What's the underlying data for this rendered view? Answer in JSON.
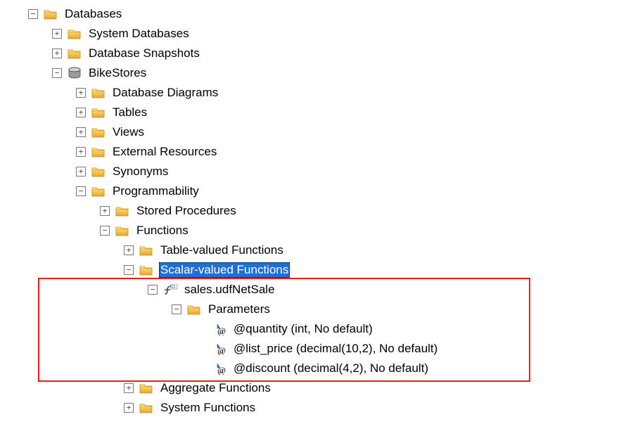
{
  "tree": {
    "databases": "Databases",
    "system_databases": "System Databases",
    "database_snapshots": "Database Snapshots",
    "bikestores": "BikeStores",
    "database_diagrams": "Database Diagrams",
    "tables": "Tables",
    "views": "Views",
    "external_resources": "External Resources",
    "synonyms": "Synonyms",
    "programmability": "Programmability",
    "stored_procedures": "Stored Procedures",
    "functions": "Functions",
    "table_valued_functions": "Table-valued Functions",
    "scalar_valued_functions": "Scalar-valued Functions",
    "function_name": "sales.udfNetSale",
    "parameters": "Parameters",
    "param_quantity": "@quantity (int, No default)",
    "param_list_price": "@list_price (decimal(10,2), No default)",
    "param_discount": "@discount (decimal(4,2), No default)",
    "aggregate_functions": "Aggregate Functions",
    "system_functions": "System Functions"
  },
  "toggles": {
    "plus": "+",
    "minus": "−"
  }
}
